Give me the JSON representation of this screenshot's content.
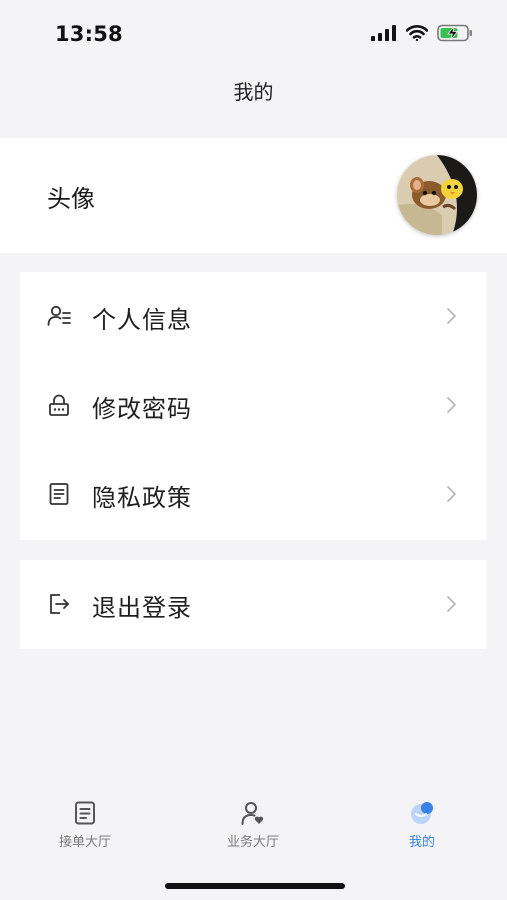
{
  "status_bar": {
    "time": "13:58",
    "icons": [
      "signal-icon",
      "wifi-icon",
      "battery-charging-icon"
    ]
  },
  "nav": {
    "title": "我的"
  },
  "profile": {
    "avatar_label": "头像"
  },
  "menu": {
    "items": [
      {
        "label": "个人信息",
        "icon": "user-info-icon"
      },
      {
        "label": "修改密码",
        "icon": "lock-icon"
      },
      {
        "label": "隐私政策",
        "icon": "document-icon"
      }
    ],
    "logout": {
      "label": "退出登录",
      "icon": "logout-icon"
    }
  },
  "tabs": [
    {
      "label": "接单大厅",
      "icon": "order-list-icon",
      "active": false
    },
    {
      "label": "业务大厅",
      "icon": "business-user-icon",
      "active": false
    },
    {
      "label": "我的",
      "icon": "mine-icon",
      "active": true
    }
  ],
  "colors": {
    "accent": "#3a82e6",
    "background": "#f4f4f6",
    "card": "#ffffff",
    "text": "#1f1f1f",
    "muted": "#7b7b7b"
  }
}
